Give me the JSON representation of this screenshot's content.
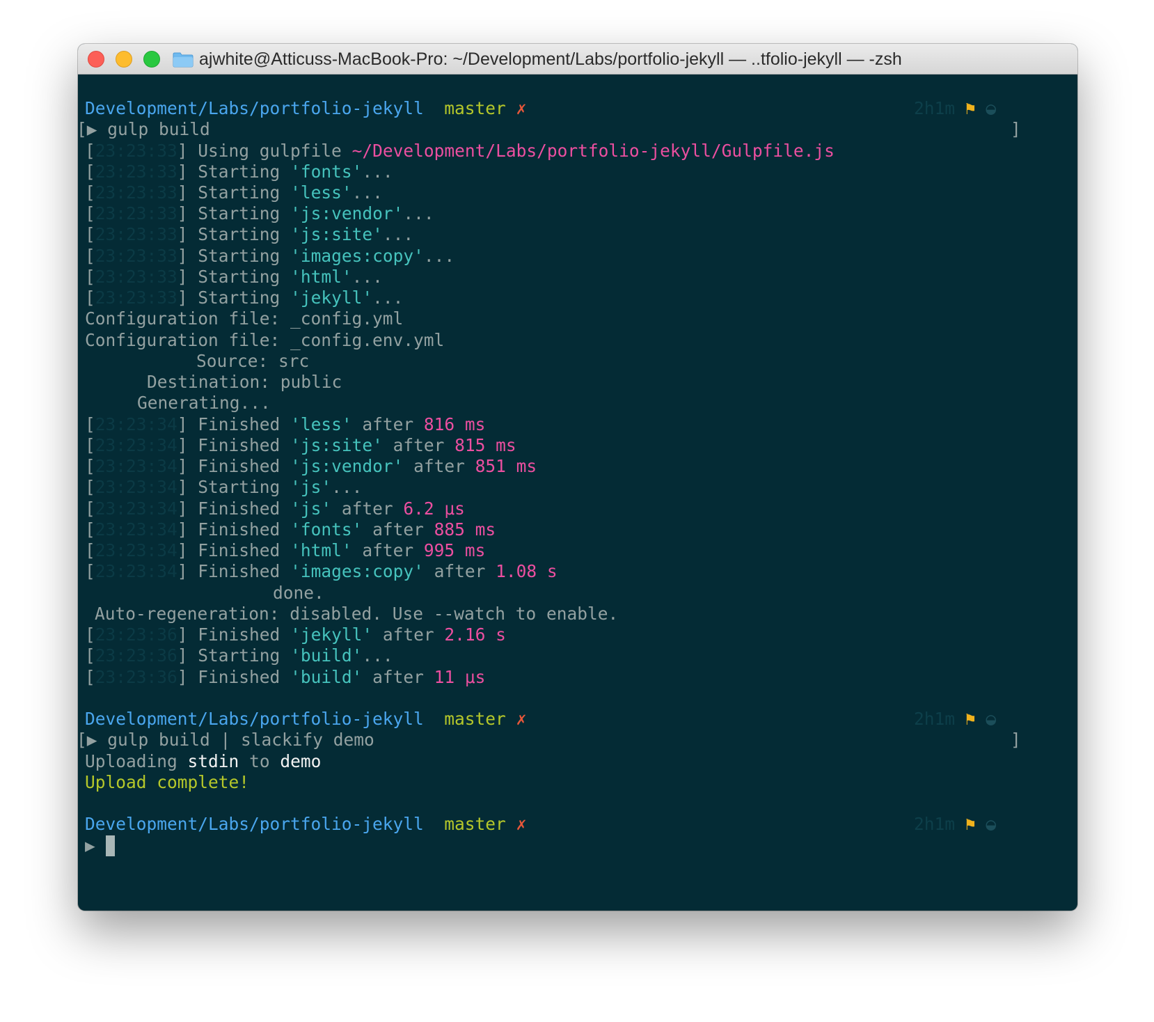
{
  "window": {
    "title": "ajwhite@Atticuss-MacBook-Pro: ~/Development/Labs/portfolio-jekyll — ..tfolio-jekyll — -zsh"
  },
  "prompt": {
    "dir": "Development/Labs/portfolio-jekyll",
    "branch": "master",
    "dirty": "✗",
    "elapsed": "2h1m",
    "flag": "⚑",
    "status_icon": "◒",
    "symbol": "▶"
  },
  "commands": {
    "first": "gulp build",
    "second": "gulp build | slackify demo"
  },
  "gulpfile": {
    "label": "Using gulpfile",
    "path": "~/Development/Labs/portfolio-jekyll/Gulpfile.js"
  },
  "timestamps": {
    "t1": "23:23:33",
    "t2": "23:23:34",
    "t3": "23:23:36"
  },
  "tasks": {
    "fonts": "'fonts'",
    "less": "'less'",
    "js_vendor": "'js:vendor'",
    "js_site": "'js:site'",
    "images_copy": "'images:copy'",
    "html": "'html'",
    "jekyll": "'jekyll'",
    "js": "'js'",
    "build": "'build'"
  },
  "words": {
    "starting": "Starting",
    "finished": "Finished",
    "after": "after",
    "ellipsis": "..."
  },
  "jekyll": {
    "config1": "Configuration file: _config.yml",
    "config2": "Configuration file: _config.env.yml",
    "source": "Source: src",
    "destination": "Destination: public",
    "generating": "Generating...",
    "done": "done.",
    "autoregen": "Auto-regeneration: disabled. Use --watch to enable."
  },
  "durations": {
    "less": "816 ms",
    "js_site": "815 ms",
    "js_vendor": "851 ms",
    "js": "6.2 μs",
    "fonts": "885 ms",
    "html": "995 ms",
    "images_copy": "1.08 s",
    "jekyll": "2.16 s",
    "build": "11 μs"
  },
  "upload": {
    "uploading": "Uploading",
    "stdin": "stdin",
    "to": "to",
    "target": "demo",
    "complete": "Upload complete!"
  },
  "colors": {
    "background": "#042b35",
    "text": "#93a1a1",
    "dir": "#4aa6ee",
    "branch": "#b5c72a",
    "dirty": "#e8573a",
    "string": "#46c3bd",
    "number": "#ec4fa0"
  }
}
